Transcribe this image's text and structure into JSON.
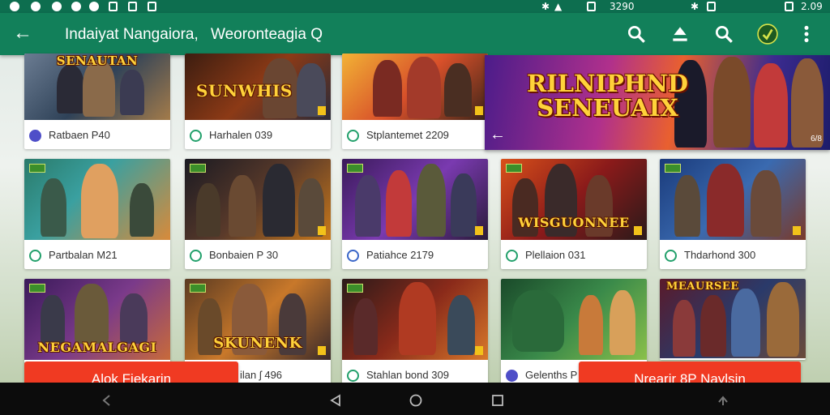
{
  "status_bar": {
    "time_left": "2.09",
    "time_right": "2.09",
    "clock_center": "3290",
    "icons": [
      "notification-icon",
      "messenger-icon",
      "alarm-icon",
      "media-icon",
      "sim-icon",
      "email-icon",
      "bluetooth-icon",
      "signal-icon",
      "battery-icon"
    ]
  },
  "app_bar": {
    "title_part1": "Indaiyat Nangaiora,",
    "title_part2": "Weoronteagia Q",
    "actions": [
      "search-icon",
      "download-icon",
      "search-icon",
      "tag-icon",
      "more-icon"
    ]
  },
  "cards": [
    {
      "art_title": "SENAUTAN",
      "meta": "Ratbaen P40",
      "meta_icon": "indigo"
    },
    {
      "art_title": "SUNWHIS",
      "meta": "Harhalen 039",
      "meta_icon": "green"
    },
    {
      "art_title": "",
      "meta": "Stplantemet 2209",
      "meta_icon": "green"
    },
    {
      "art_title": "",
      "meta": "Partbalan M21",
      "meta_icon": "green"
    },
    {
      "art_title": "",
      "meta": "Bonbaien P 30",
      "meta_icon": "green"
    },
    {
      "art_title": "",
      "meta": "Patiahce 2179",
      "meta_icon": "blue"
    },
    {
      "art_title": "WISGUONNEE",
      "meta": "Plellaion 031",
      "meta_icon": "green"
    },
    {
      "art_title": "",
      "meta": "Thdarhond 300",
      "meta_icon": "green"
    },
    {
      "art_title": "NEGAMALGAGI",
      "meta": "",
      "meta_icon": "green"
    },
    {
      "art_title": "SKUNENK",
      "meta": "ilan ʃ 496",
      "meta_icon": "green"
    },
    {
      "art_title": "",
      "meta": "Stahlan bond 309",
      "meta_icon": "green"
    },
    {
      "art_title": "",
      "meta": "Gelenths P",
      "meta_icon": "indigo"
    },
    {
      "art_title": "MEAURSEE",
      "meta": "",
      "meta_icon": "green"
    }
  ],
  "banner": {
    "title_line1": "RILNIPHND",
    "title_line2": "SENEUAIX",
    "counter": "6/8"
  },
  "buttons": {
    "left": "Alok Fiekarin",
    "right": "Nrearir 8P Naylsin"
  },
  "colors": {
    "status_bar": "#0d6e4f",
    "app_bar": "#12805a",
    "button": "#f03a22",
    "nav_bar": "#0c0c0c"
  }
}
